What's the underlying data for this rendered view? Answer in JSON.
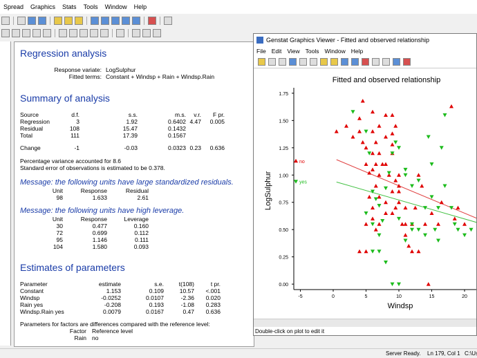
{
  "app": {
    "menu": [
      "Spread",
      "Graphics",
      "Stats",
      "Tools",
      "Window",
      "Help"
    ]
  },
  "status": {
    "ready": "Server Ready.",
    "position": "Ln 179, Col 1",
    "path": "C:\\Use"
  },
  "output": {
    "regression": {
      "heading": "Regression analysis",
      "response_label": "Response variate:",
      "response_value": "LogSulphur",
      "fitted_label": "Fitted terms:",
      "fitted_value": "Constant + Windsp + Rain + Windsp.Rain"
    },
    "summary": {
      "heading": "Summary of analysis",
      "columns": [
        "Source",
        "d.f.",
        "s.s.",
        "m.s.",
        "v.r.",
        "F pr."
      ],
      "rows": [
        [
          "Regression",
          "3",
          "1.92",
          "0.6402",
          "4.47",
          "0.005"
        ],
        [
          "Residual",
          "108",
          "15.47",
          "0.1432",
          "",
          ""
        ],
        [
          "Total",
          "111",
          "17.39",
          "0.1567",
          "",
          ""
        ],
        [
          "Change",
          "-1",
          "-0.03",
          "0.0323",
          "0.23",
          "0.636"
        ]
      ],
      "note1": "Percentage variance accounted for 8.6",
      "note2": "Standard error of observations is estimated to be 0.378."
    },
    "msg1": {
      "text": "Message: the following units have large standardized residuals.",
      "columns": [
        "Unit",
        "Response",
        "Residual"
      ],
      "rows": [
        [
          "98",
          "1.633",
          "2.61"
        ]
      ]
    },
    "msg2": {
      "text": "Message: the following units have high leverage.",
      "columns": [
        "Unit",
        "Response",
        "Leverage"
      ],
      "rows": [
        [
          "30",
          "0.477",
          "0.160"
        ],
        [
          "72",
          "0.699",
          "0.112"
        ],
        [
          "95",
          "1.146",
          "0.111"
        ],
        [
          "104",
          "1.580",
          "0.093"
        ]
      ]
    },
    "estimates": {
      "heading": "Estimates of parameters",
      "columns": [
        "Parameter",
        "estimate",
        "s.e.",
        "t(108)",
        "t pr."
      ],
      "rows": [
        [
          "Constant",
          "1.153",
          "0.109",
          "10.57",
          "<.001"
        ],
        [
          "Windsp",
          "-0.0252",
          "0.0107",
          "-2.36",
          "0.020"
        ],
        [
          "Rain yes",
          "-0.208",
          "0.193",
          "-1.08",
          "0.283"
        ],
        [
          "Windsp.Rain yes",
          "0.0079",
          "0.0167",
          "0.47",
          "0.636"
        ]
      ],
      "note": "Parameters for factors are differences compared with the reference level:",
      "ref_factor_label": "Factor",
      "ref_level_label": "Reference level",
      "ref_factor": "Rain",
      "ref_level": "no"
    }
  },
  "graph_viewer": {
    "window_title": "Genstat Graphics Viewer - Fitted and observed relationship",
    "menu": [
      "File",
      "Edit",
      "View",
      "Tools",
      "Window",
      "Help"
    ],
    "status": "Double-click on plot to edit it"
  },
  "chart_data": {
    "type": "scatter",
    "title": "Fitted and observed relationship",
    "xlabel": "Windsp",
    "ylabel": "LogSulphur",
    "xlim": [
      -6,
      22
    ],
    "ylim": [
      -0.05,
      1.8
    ],
    "x_ticks": [
      "-5",
      "0",
      "5",
      "10",
      "15",
      "20"
    ],
    "x_tick_values": [
      -5,
      0,
      5,
      10,
      15,
      20
    ],
    "y_ticks": [
      "0.00",
      "0.25",
      "0.50",
      "0.75",
      "1.00",
      "1.25",
      "1.50",
      "1.75"
    ],
    "y_tick_values": [
      0,
      0.25,
      0.5,
      0.75,
      1.0,
      1.25,
      1.5,
      1.75
    ],
    "series": [
      {
        "name": "no",
        "color": "#e00000",
        "marker": "triangle-up",
        "points": [
          [
            0.5,
            1.4
          ],
          [
            2,
            1.45
          ],
          [
            3,
            1.35
          ],
          [
            4,
            1.52
          ],
          [
            4.5,
            1.68
          ],
          [
            4,
            1.4
          ],
          [
            4.5,
            1.3
          ],
          [
            5,
            1.25
          ],
          [
            5,
            1.1
          ],
          [
            5.5,
            1.02
          ],
          [
            6,
            1.58
          ],
          [
            6,
            1.4
          ],
          [
            6,
            1.2
          ],
          [
            6,
            1.05
          ],
          [
            6.5,
            1.3
          ],
          [
            6.5,
            1.1
          ],
          [
            6.5,
            0.9
          ],
          [
            7,
            1.45
          ],
          [
            7,
            1.2
          ],
          [
            7,
            1.0
          ],
          [
            7.5,
            1.1
          ],
          [
            8,
            1.55
          ],
          [
            8,
            1.35
          ],
          [
            8,
            1.1
          ],
          [
            8.5,
            1.0
          ],
          [
            9,
            1.55
          ],
          [
            9,
            1.38
          ],
          [
            9,
            1.28
          ],
          [
            9,
            1.2
          ],
          [
            9.5,
            1.45
          ],
          [
            9,
            0.85
          ],
          [
            9.5,
            0.7
          ],
          [
            10,
            0.9
          ],
          [
            10,
            0.75
          ],
          [
            10,
            1.0
          ],
          [
            10,
            0.85
          ],
          [
            11,
            0.7
          ],
          [
            11,
            0.45
          ],
          [
            12,
            0.55
          ],
          [
            12.5,
            0.7
          ],
          [
            13,
            1.0
          ],
          [
            13.5,
            0.9
          ],
          [
            14,
            0.55
          ],
          [
            14.5,
            0.0
          ],
          [
            15,
            0.65
          ],
          [
            16,
            0.55
          ],
          [
            16.5,
            0.75
          ],
          [
            18,
            1.63
          ],
          [
            18.5,
            0.6
          ],
          [
            19,
            0.7
          ],
          [
            20,
            0.55
          ],
          [
            5,
            0.55
          ],
          [
            6,
            0.6
          ],
          [
            7,
            0.55
          ],
          [
            8,
            0.65
          ],
          [
            9,
            0.65
          ],
          [
            9.5,
            0.95
          ],
          [
            5,
            0.3
          ],
          [
            6,
            0.7
          ],
          [
            7,
            0.8
          ],
          [
            8,
            0.75
          ],
          [
            5.5,
            0.8
          ],
          [
            10.5,
            0.55
          ],
          [
            11.5,
            0.35
          ],
          [
            13,
            0.3
          ],
          [
            12,
            0.3
          ],
          [
            6.5,
            0.5
          ],
          [
            4,
            0.3
          ],
          [
            11,
            0.55
          ]
        ]
      },
      {
        "name": "yes",
        "color": "#1cbb1c",
        "marker": "triangle-down",
        "points": [
          [
            3,
            1.58
          ],
          [
            5,
            1.4
          ],
          [
            5.5,
            1.2
          ],
          [
            6,
            0.85
          ],
          [
            6.5,
            0.78
          ],
          [
            7,
            0.72
          ],
          [
            7.5,
            0.58
          ],
          [
            8,
            0.88
          ],
          [
            8.5,
            1.02
          ],
          [
            9,
            1.2
          ],
          [
            9.5,
            1.3
          ],
          [
            10,
            1.25
          ],
          [
            11,
            1.0
          ],
          [
            11,
            1.05
          ],
          [
            10,
            0.6
          ],
          [
            11,
            0.4
          ],
          [
            12,
            0.5
          ],
          [
            13,
            0.5
          ],
          [
            14,
            0.45
          ],
          [
            14.5,
            1.35
          ],
          [
            15,
            1.1
          ],
          [
            15.5,
            0.5
          ],
          [
            16,
            0.4
          ],
          [
            17,
            0.9
          ],
          [
            18,
            0.7
          ],
          [
            19,
            0.5
          ],
          [
            20,
            0.45
          ],
          [
            21,
            0.5
          ],
          [
            6,
            0.3
          ],
          [
            7,
            0.3
          ],
          [
            8,
            0.2
          ],
          [
            9,
            0.0
          ],
          [
            10,
            0.0
          ],
          [
            5,
            0.65
          ],
          [
            6,
            0.55
          ],
          [
            7,
            0.45
          ],
          [
            14,
            0.7
          ],
          [
            15,
            0.8
          ],
          [
            12,
            0.9
          ],
          [
            17,
            1.55
          ],
          [
            16.5,
            1.25
          ],
          [
            16,
            0.7
          ],
          [
            13,
            0.95
          ],
          [
            12,
            0.55
          ],
          [
            18.5,
            0.55
          ]
        ]
      }
    ],
    "fitted": [
      {
        "name": "no",
        "color": "#e04040",
        "from": [
          0.5,
          1.141
        ],
        "to": [
          22,
          0.6
        ]
      },
      {
        "name": "yes",
        "color": "#40c040",
        "from": [
          0.5,
          0.936
        ],
        "to": [
          22,
          0.563
        ]
      }
    ],
    "legend": [
      {
        "label": "no",
        "color": "#e00000",
        "y": 1.13
      },
      {
        "label": "yes",
        "color": "#1cbb1c",
        "y": 0.94
      }
    ]
  }
}
